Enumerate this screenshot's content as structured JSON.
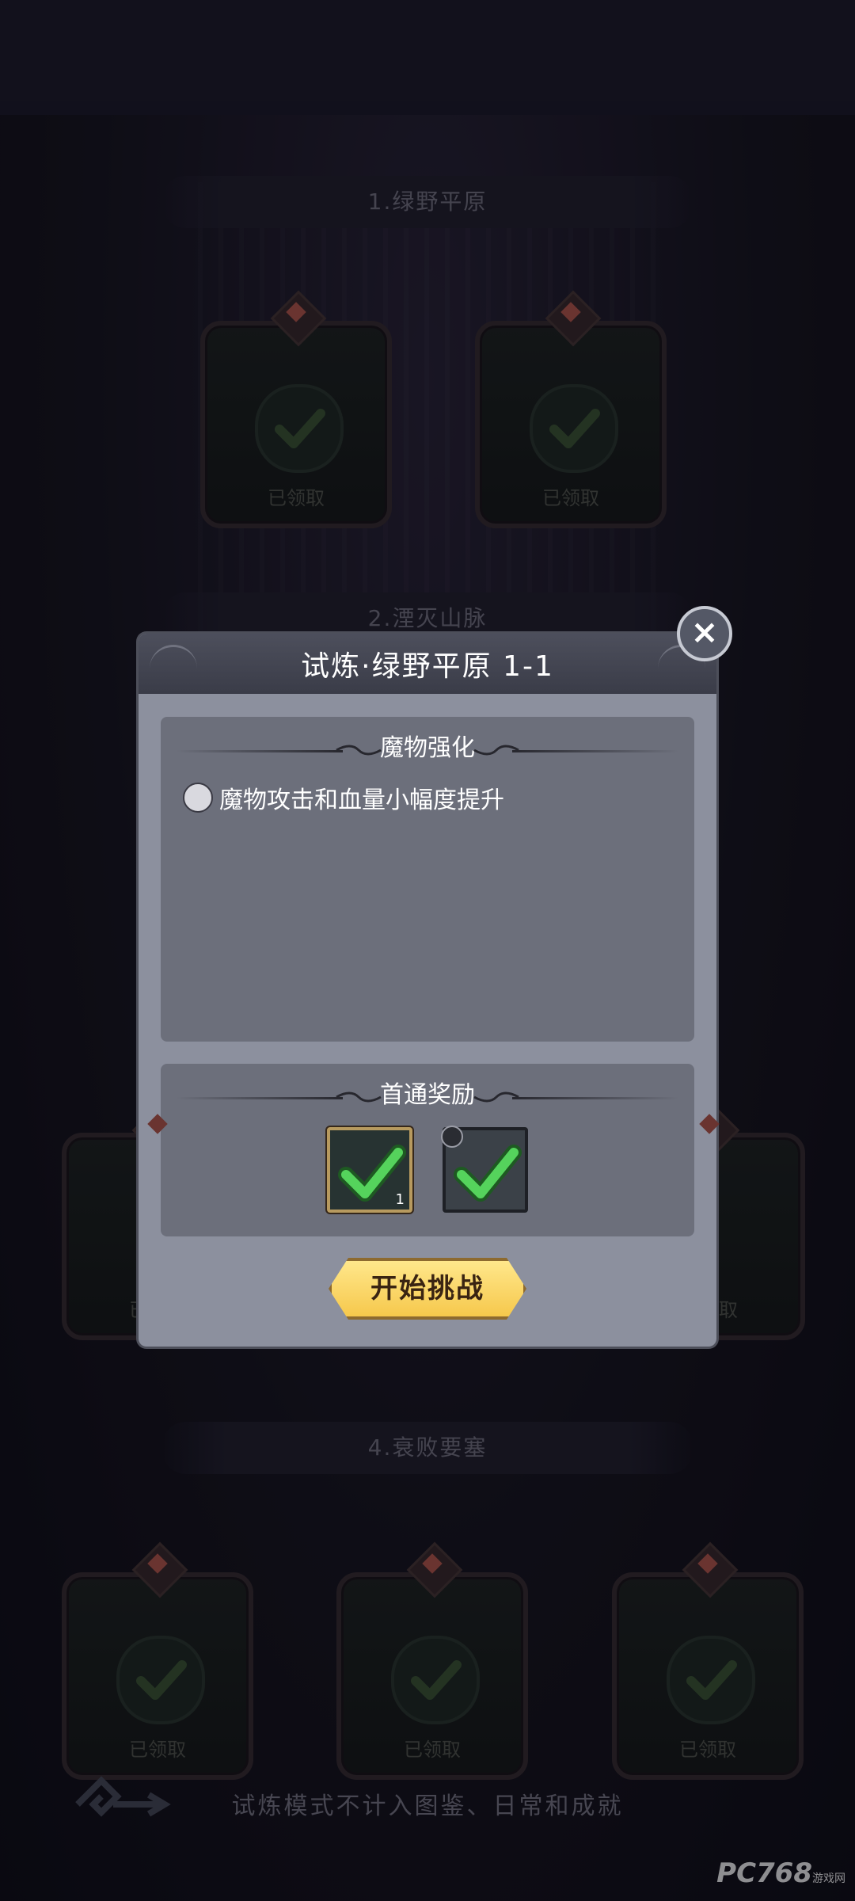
{
  "sections": {
    "s1_title": "1.绿野平原",
    "s2_title": "2.湮灭山脉",
    "s4_title": "4.衰败要塞",
    "claimed_label": "已领取"
  },
  "footer": {
    "notice": "试炼模式不计入图鉴、日常和成就"
  },
  "watermark": {
    "brand": "PC768",
    "suffix": "游戏网"
  },
  "modal": {
    "title": "试炼·绿野平原 1-1",
    "close_icon": "×",
    "effect_panel": {
      "title": "魔物强化",
      "effect_text": "魔物攻击和血量小幅度提升"
    },
    "reward_panel": {
      "title": "首通奖励",
      "rewards": [
        {
          "name": "armor-reward",
          "count": "1",
          "claimed": true
        },
        {
          "name": "card-reward",
          "count": "",
          "claimed": true
        }
      ]
    },
    "start_button": "开始挑战"
  },
  "colors": {
    "accent_gold": "#f6c84c",
    "check_green": "#3cc24a",
    "modal_bg": "#8c909e"
  }
}
